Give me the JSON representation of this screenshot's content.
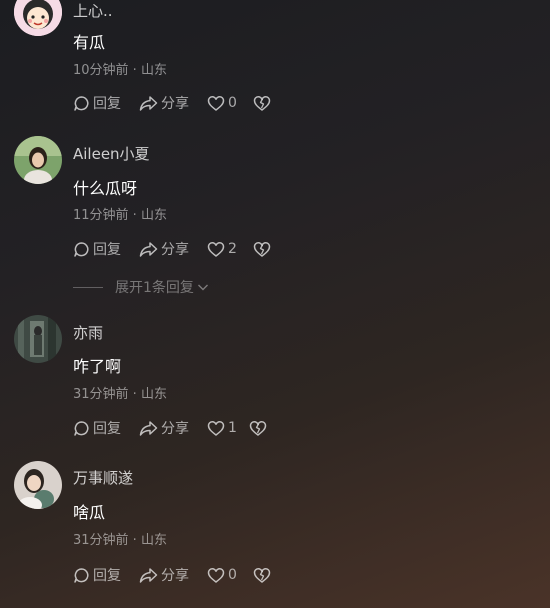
{
  "comments": [
    {
      "username": "上心..",
      "text": "有瓜",
      "meta": "10分钟前 · 山东",
      "reply_label": "回复",
      "share_label": "分享",
      "likes": "0"
    },
    {
      "username": "Aileen小夏",
      "text": "什么瓜呀",
      "meta": "11分钟前 · 山东",
      "reply_label": "回复",
      "share_label": "分享",
      "likes": "2",
      "expand_label": "展开1条回复"
    },
    {
      "username": "亦雨",
      "text": "咋了啊",
      "meta": "31分钟前 · 山东",
      "reply_label": "回复",
      "share_label": "分享",
      "likes": "1"
    },
    {
      "username": "万事顺遂",
      "text": "啥瓜",
      "meta": "31分钟前 · 山东",
      "reply_label": "回复",
      "share_label": "分享",
      "likes": "0"
    }
  ],
  "icons": {
    "reply": "comment-bubble-icon",
    "share": "share-arrow-icon",
    "like": "heart-outline-icon",
    "dislike": "broken-heart-icon",
    "expand": "chevron-down-icon"
  },
  "colors": {
    "text_primary": "#ffffff",
    "text_secondary": "#c7c7c7",
    "text_meta": "#808080"
  }
}
